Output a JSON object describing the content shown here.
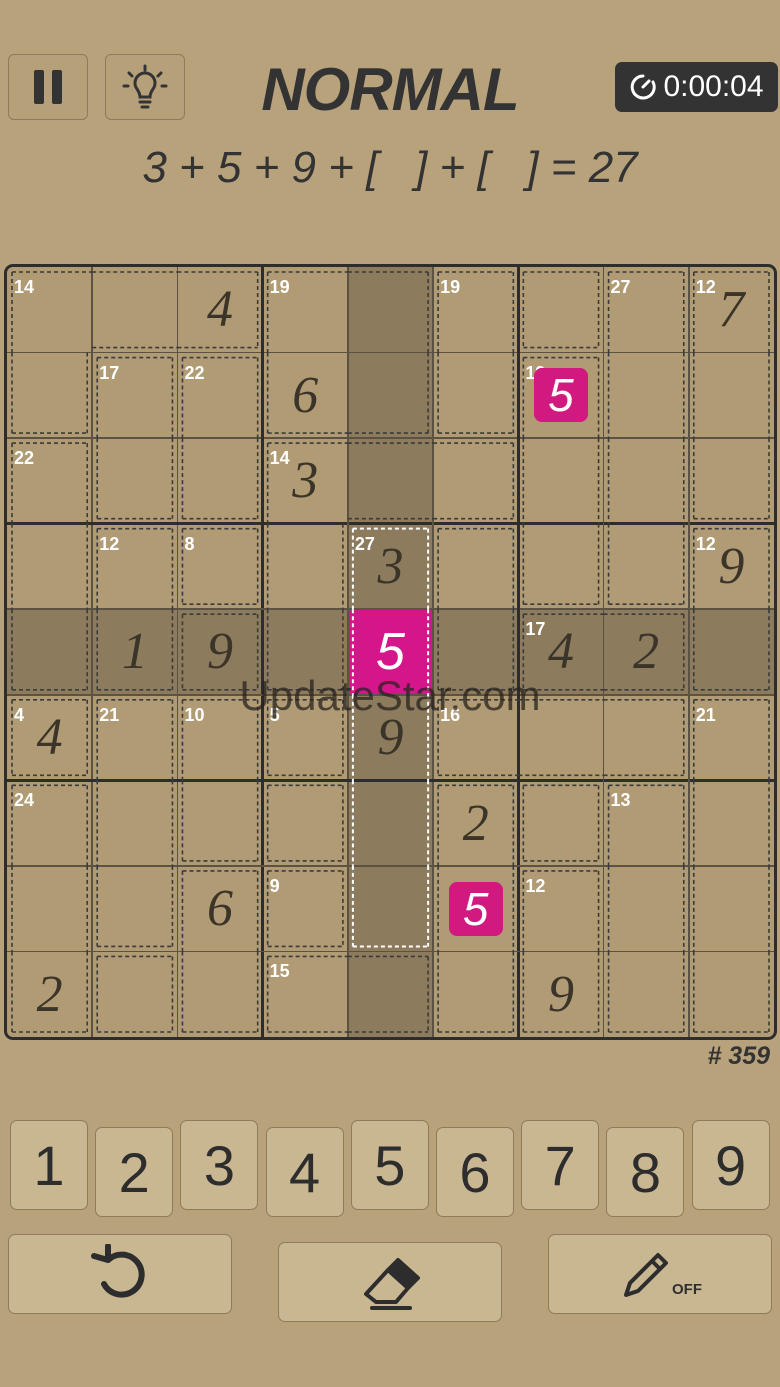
{
  "header": {
    "difficulty": "NORMAL",
    "timer": "0:00:04"
  },
  "equation": {
    "text": "3 + 5 + 9 + [   ] + [   ] = 27"
  },
  "board": {
    "rows": [
      [
        "",
        "",
        "4",
        "",
        "",
        "",
        "",
        "",
        "7"
      ],
      [
        "",
        "",
        "",
        "6",
        "",
        "",
        "5",
        "",
        ""
      ],
      [
        "",
        "",
        "",
        "3",
        "",
        "",
        "",
        "",
        ""
      ],
      [
        "",
        "",
        "",
        "",
        "3",
        "",
        "",
        "",
        "9"
      ],
      [
        "",
        "1",
        "9",
        "",
        "5",
        "",
        "4",
        "2",
        ""
      ],
      [
        "4",
        "",
        "",
        "",
        "9",
        "",
        "",
        "",
        ""
      ],
      [
        "",
        "",
        "",
        "",
        "",
        "2",
        "",
        "",
        ""
      ],
      [
        "",
        "",
        "6",
        "",
        "",
        "5",
        "",
        "",
        ""
      ],
      [
        "2",
        "",
        "",
        "",
        "",
        "",
        "9",
        "",
        ""
      ]
    ],
    "entered_cells": [
      [
        1,
        6
      ],
      [
        7,
        5
      ]
    ],
    "selected_cell": [
      4,
      4
    ],
    "highlighted_row": 4,
    "highlighted_col": 4,
    "cages": [
      {
        "sum": "14",
        "cells": [
          [
            0,
            0
          ],
          [
            0,
            1
          ],
          [
            0,
            2
          ],
          [
            1,
            0
          ]
        ]
      },
      {
        "sum": "19",
        "cells": [
          [
            0,
            3
          ],
          [
            0,
            4
          ],
          [
            1,
            3
          ],
          [
            1,
            4
          ]
        ]
      },
      {
        "sum": "19",
        "cells": [
          [
            0,
            5
          ],
          [
            1,
            5
          ]
        ]
      },
      {
        "sum": "",
        "cells": [
          [
            0,
            6
          ]
        ]
      },
      {
        "sum": "27",
        "cells": [
          [
            0,
            7
          ],
          [
            1,
            7
          ],
          [
            2,
            7
          ],
          [
            3,
            7
          ]
        ]
      },
      {
        "sum": "12",
        "cells": [
          [
            0,
            8
          ],
          [
            1,
            8
          ],
          [
            2,
            8
          ]
        ]
      },
      {
        "sum": "17",
        "cells": [
          [
            1,
            1
          ],
          [
            2,
            1
          ]
        ]
      },
      {
        "sum": "22",
        "cells": [
          [
            1,
            2
          ],
          [
            2,
            2
          ]
        ]
      },
      {
        "sum": "19",
        "cells": [
          [
            1,
            6
          ],
          [
            2,
            6
          ],
          [
            3,
            6
          ]
        ]
      },
      {
        "sum": "22",
        "cells": [
          [
            2,
            0
          ],
          [
            3,
            0
          ],
          [
            4,
            0
          ]
        ]
      },
      {
        "sum": "14",
        "cells": [
          [
            2,
            3
          ],
          [
            2,
            4
          ],
          [
            2,
            5
          ],
          [
            3,
            3
          ],
          [
            4,
            3
          ]
        ]
      },
      {
        "sum": "12",
        "cells": [
          [
            3,
            1
          ],
          [
            4,
            1
          ]
        ]
      },
      {
        "sum": "8",
        "cells": [
          [
            3,
            2
          ]
        ]
      },
      {
        "sum": "27",
        "cells": [
          [
            3,
            4
          ],
          [
            4,
            4
          ],
          [
            5,
            4
          ],
          [
            6,
            4
          ],
          [
            7,
            4
          ]
        ]
      },
      {
        "sum": "",
        "cells": [
          [
            3,
            5
          ],
          [
            4,
            5
          ]
        ]
      },
      {
        "sum": "12",
        "cells": [
          [
            3,
            8
          ],
          [
            4,
            8
          ]
        ]
      },
      {
        "sum": "",
        "cells": [
          [
            4,
            2
          ]
        ]
      },
      {
        "sum": "17",
        "cells": [
          [
            4,
            6
          ],
          [
            4,
            7
          ]
        ]
      },
      {
        "sum": "4",
        "cells": [
          [
            5,
            0
          ]
        ]
      },
      {
        "sum": "21",
        "cells": [
          [
            5,
            1
          ],
          [
            6,
            1
          ],
          [
            7,
            1
          ]
        ]
      },
      {
        "sum": "10",
        "cells": [
          [
            5,
            2
          ],
          [
            6,
            2
          ]
        ]
      },
      {
        "sum": "5",
        "cells": [
          [
            5,
            3
          ]
        ]
      },
      {
        "sum": "16",
        "cells": [
          [
            5,
            5
          ],
          [
            5,
            6
          ],
          [
            5,
            7
          ]
        ]
      },
      {
        "sum": "21",
        "cells": [
          [
            5,
            8
          ],
          [
            6,
            8
          ],
          [
            7,
            8
          ],
          [
            8,
            8
          ]
        ]
      },
      {
        "sum": "24",
        "cells": [
          [
            6,
            0
          ],
          [
            7,
            0
          ],
          [
            8,
            0
          ]
        ]
      },
      {
        "sum": "",
        "cells": [
          [
            6,
            3
          ]
        ]
      },
      {
        "sum": "",
        "cells": [
          [
            6,
            5
          ],
          [
            7,
            5
          ],
          [
            8,
            5
          ]
        ]
      },
      {
        "sum": "",
        "cells": [
          [
            6,
            6
          ]
        ]
      },
      {
        "sum": "13",
        "cells": [
          [
            6,
            7
          ],
          [
            7,
            7
          ],
          [
            8,
            7
          ]
        ]
      },
      {
        "sum": "9",
        "cells": [
          [
            7,
            3
          ]
        ]
      },
      {
        "sum": "12",
        "cells": [
          [
            7,
            6
          ],
          [
            8,
            6
          ]
        ]
      },
      {
        "sum": "",
        "cells": [
          [
            7,
            2
          ],
          [
            8,
            2
          ]
        ]
      },
      {
        "sum": "",
        "cells": [
          [
            8,
            1
          ]
        ]
      },
      {
        "sum": "15",
        "cells": [
          [
            8,
            3
          ],
          [
            8,
            4
          ]
        ]
      }
    ],
    "active_cage_index": 13
  },
  "puzzle_number": "# 359",
  "keypad": [
    "1",
    "2",
    "3",
    "4",
    "5",
    "6",
    "7",
    "8",
    "9"
  ],
  "pencil_state": "OFF",
  "watermark": "UpdateStar.com",
  "colors": {
    "background": "#b8a27c",
    "highlight": "#8d7b5e",
    "selected": "#d4168a",
    "entered": "#d1197f"
  }
}
